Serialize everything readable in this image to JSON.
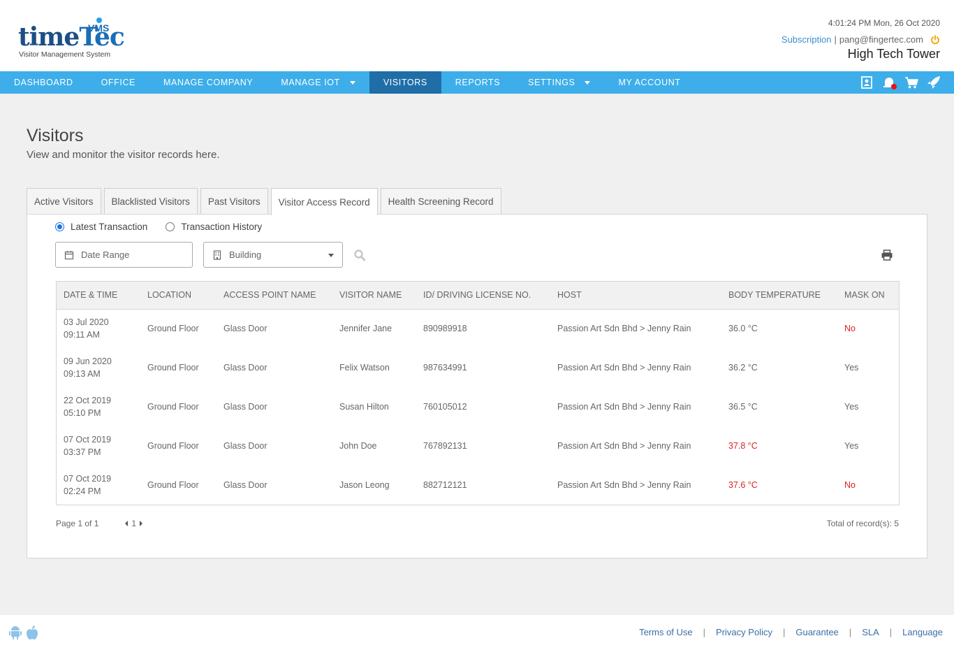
{
  "header": {
    "logo": {
      "word_time": "time",
      "word_tec": "Tec",
      "vms": "VMS",
      "tagline": "Visitor Management System"
    },
    "datetime": "4:01:24 PM  Mon, 26 Oct 2020",
    "subscription_label": "Subscription",
    "separator": "|",
    "user_email": "pang@fingertec.com",
    "building_name": "High Tech Tower",
    "icons": [
      "power-icon"
    ]
  },
  "nav": {
    "items": [
      {
        "label": "DASHBOARD",
        "caret": false,
        "active": false
      },
      {
        "label": "OFFICE",
        "caret": false,
        "active": false
      },
      {
        "label": "MANAGE COMPANY",
        "caret": false,
        "active": false
      },
      {
        "label": "MANAGE IOT",
        "caret": true,
        "active": false
      },
      {
        "label": "VISITORS",
        "caret": false,
        "active": true
      },
      {
        "label": "REPORTS",
        "caret": false,
        "active": false
      },
      {
        "label": "SETTINGS",
        "caret": true,
        "active": false
      },
      {
        "label": "MY ACCOUNT",
        "caret": false,
        "active": false
      }
    ],
    "icons": [
      "contact-card-icon",
      "notification-bell-icon",
      "cart-icon",
      "rocket-icon"
    ],
    "accent_color": "#3daee9",
    "active_color": "#1f6ea8"
  },
  "page": {
    "title": "Visitors",
    "subtitle": "View and monitor the visitor records here."
  },
  "tabs": [
    {
      "label": "Active Visitors",
      "active": false
    },
    {
      "label": "Blacklisted Visitors",
      "active": false
    },
    {
      "label": "Past Visitors",
      "active": false
    },
    {
      "label": "Visitor Access Record",
      "active": true
    },
    {
      "label": "Health Screening Record",
      "active": false
    }
  ],
  "filters": {
    "radio_latest": "Latest Transaction",
    "radio_history": "Transaction History",
    "selected_radio": "latest",
    "date_range_placeholder": "Date Range",
    "building_placeholder": "Building",
    "icons": [
      "calendar-icon",
      "building-icon",
      "search-icon",
      "print-icon"
    ]
  },
  "table": {
    "columns": [
      "DATE & TIME",
      "LOCATION",
      "ACCESS POINT NAME",
      "VISITOR NAME",
      "ID/ DRIVING LICENSE NO.",
      "HOST",
      "BODY TEMPERATURE",
      "MASK ON"
    ],
    "rows": [
      {
        "date": "03 Jul 2020",
        "time": "09:11 AM",
        "location": "Ground Floor",
        "access_point": "Glass Door",
        "visitor": "Jennifer Jane",
        "id_no": "890989918",
        "host": "Passion Art Sdn Bhd > Jenny Rain",
        "temperature": "36.0 °C",
        "temp_alert": false,
        "mask": "No",
        "mask_alert": true
      },
      {
        "date": "09 Jun 2020",
        "time": "09:13 AM",
        "location": "Ground Floor",
        "access_point": "Glass Door",
        "visitor": "Felix Watson",
        "id_no": "987634991",
        "host": "Passion Art Sdn Bhd > Jenny Rain",
        "temperature": "36.2 °C",
        "temp_alert": false,
        "mask": "Yes",
        "mask_alert": false
      },
      {
        "date": "22 Oct 2019",
        "time": "05:10 PM",
        "location": "Ground Floor",
        "access_point": "Glass Door",
        "visitor": "Susan Hilton",
        "id_no": "760105012",
        "host": "Passion Art Sdn Bhd > Jenny Rain",
        "temperature": "36.5 °C",
        "temp_alert": false,
        "mask": "Yes",
        "mask_alert": false
      },
      {
        "date": "07 Oct 2019",
        "time": "03:37 PM",
        "location": "Ground Floor",
        "access_point": "Glass Door",
        "visitor": "John Doe",
        "id_no": "767892131",
        "host": "Passion Art Sdn Bhd > Jenny Rain",
        "temperature": "37.8 °C",
        "temp_alert": true,
        "mask": "Yes",
        "mask_alert": false
      },
      {
        "date": "07 Oct 2019",
        "time": "02:24 PM",
        "location": "Ground Floor",
        "access_point": "Glass Door",
        "visitor": "Jason Leong",
        "id_no": "882712121",
        "host": "Passion Art Sdn Bhd > Jenny Rain",
        "temperature": "37.6 °C",
        "temp_alert": true,
        "mask": "No",
        "mask_alert": true
      }
    ],
    "alert_color": "#e02020"
  },
  "pagination": {
    "page_info": "Page 1 of 1",
    "current_page": "1",
    "total": "Total of record(s): 5"
  },
  "footer": {
    "app_icons": [
      "android-icon",
      "apple-icon"
    ],
    "links": [
      "Terms of Use",
      "Privacy Policy",
      "Guarantee",
      "SLA",
      "Language"
    ],
    "separator": "|"
  }
}
